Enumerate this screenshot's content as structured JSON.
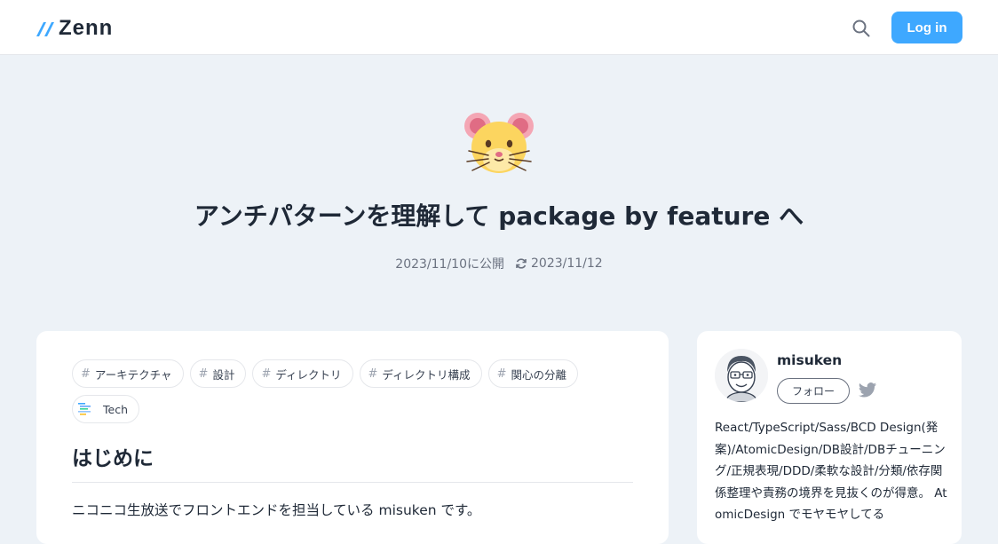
{
  "header": {
    "logo_text": "Zenn",
    "login_label": "Log in",
    "accent_color": "#3ea8ff",
    "search_icon": "search-icon"
  },
  "article": {
    "emoji": "hamster-face",
    "title": "アンチパターンを理解して package by feature へ",
    "published": "2023/11/10に公開",
    "updated": "2023/11/12",
    "topics": [
      {
        "label": "アーキテクチャ"
      },
      {
        "label": "設計"
      },
      {
        "label": "ディレクトリ"
      },
      {
        "label": "ディレクトリ構成"
      },
      {
        "label": "関心の分離"
      }
    ],
    "type_badge": "Tech",
    "section_heading": "はじめに",
    "intro": "ニコニコ生放送でフロントエンドを担当している misuken です。"
  },
  "author": {
    "name": "misuken",
    "follow_label": "フォロー",
    "bio": "React/TypeScript/Sass/BCD Design(発案)/AtomicDesign/DB設計/DBチューニング/正規表現/DDD/柔軟な設計/分類/依存関係整理や責務の境界を見抜くのが得意。 AtomicDesign でモヤモヤしてる"
  }
}
